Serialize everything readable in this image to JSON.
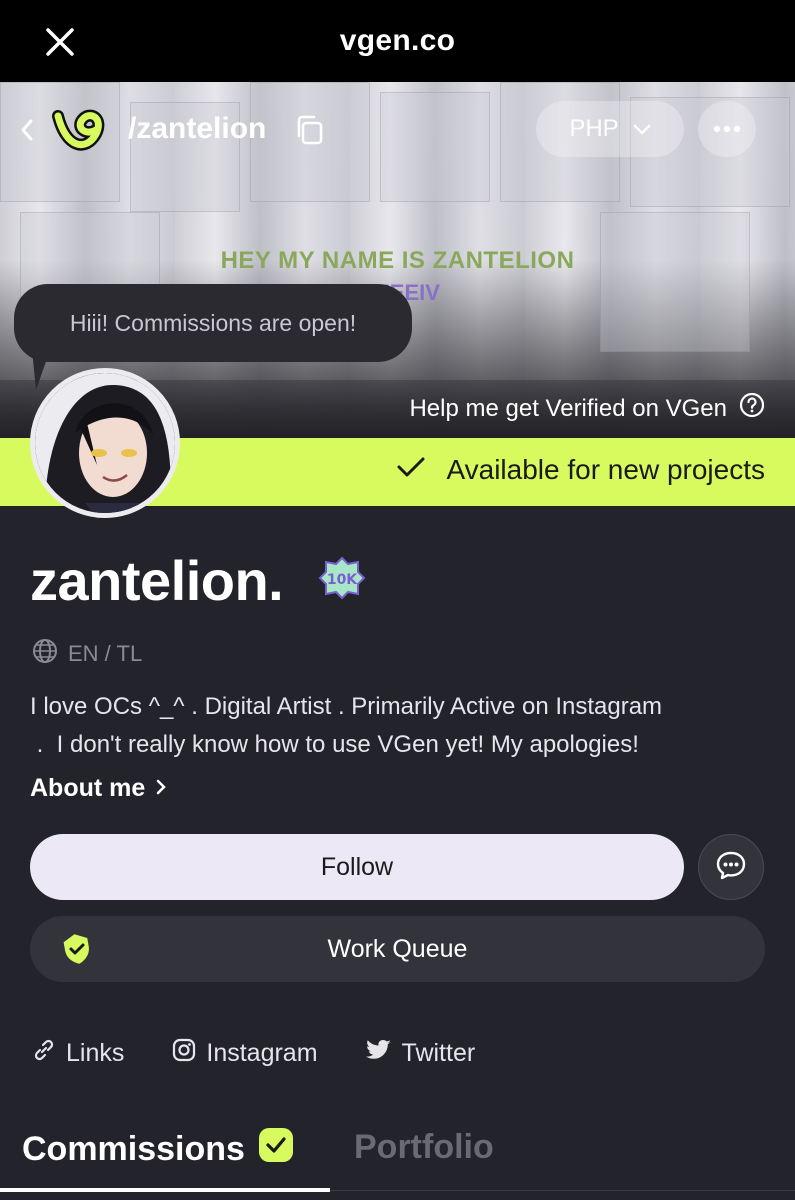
{
  "browser": {
    "domain": "vgen.co"
  },
  "header": {
    "handle": "/zantelion",
    "currency": "PHP"
  },
  "banner": {
    "headline": "HEY MY NAME IS ZANTELION",
    "subline": "EEEIV"
  },
  "status_bubble": "Hiii! Commissions are open!",
  "verify_link": "Help me get Verified on VGen",
  "availability": "Available for new projects",
  "profile": {
    "name": "zantelion.",
    "languages": "EN / TL",
    "bio_line1": "I love OCs ^_^  .  Digital Artist  .  Primarily Active on Instagram",
    "bio_line2": " .  I don't really know how to use VGen yet! My apologies!",
    "about_label": "About me"
  },
  "actions": {
    "follow": "Follow",
    "work_queue": "Work Queue"
  },
  "socials": {
    "links": "Links",
    "instagram": "Instagram",
    "twitter": "Twitter"
  },
  "tabs": {
    "commissions": "Commissions",
    "portfolio": "Portfolio"
  },
  "colors": {
    "accent_lime": "#d7fb5e",
    "background": "#23232b",
    "follow_bg": "#ece8f5"
  }
}
